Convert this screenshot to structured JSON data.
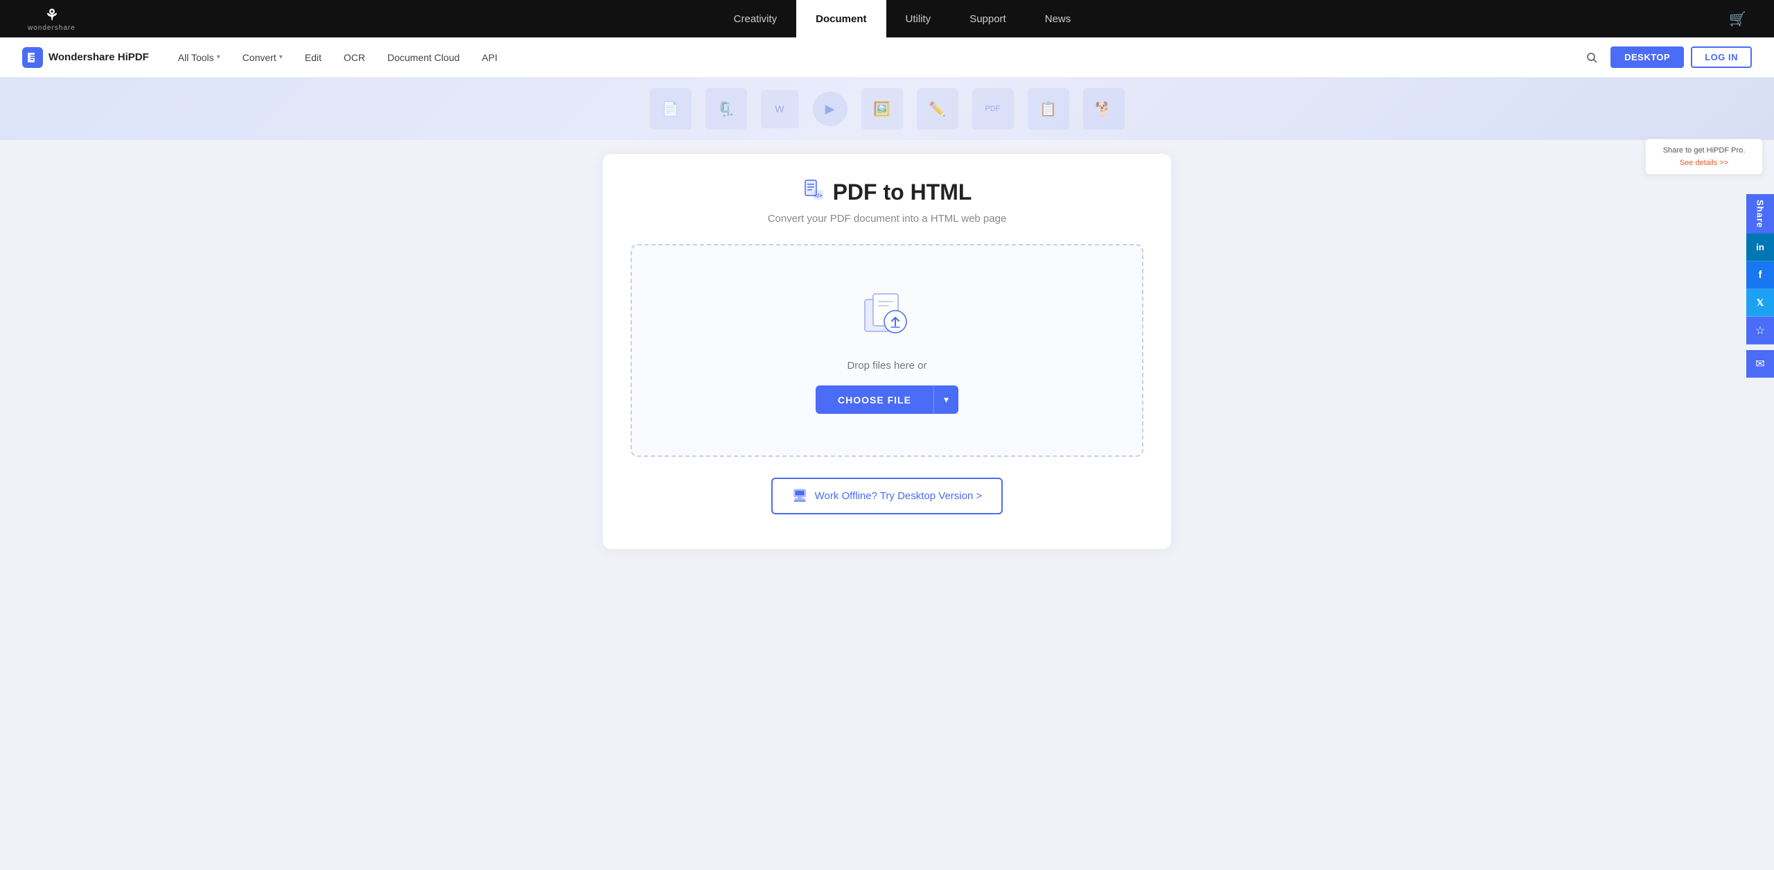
{
  "topNav": {
    "logo": {
      "icon": "⌘",
      "text": "wondershare"
    },
    "links": [
      {
        "id": "creativity",
        "label": "Creativity",
        "active": false
      },
      {
        "id": "document",
        "label": "Document",
        "active": true
      },
      {
        "id": "utility",
        "label": "Utility",
        "active": false
      },
      {
        "id": "support",
        "label": "Support",
        "active": false
      },
      {
        "id": "news",
        "label": "News",
        "active": false
      }
    ],
    "cartIcon": "🛒"
  },
  "secondaryNav": {
    "brand": {
      "name": "Wondershare HiPDF"
    },
    "links": [
      {
        "id": "all-tools",
        "label": "All Tools",
        "hasDropdown": true
      },
      {
        "id": "convert",
        "label": "Convert",
        "hasDropdown": true
      },
      {
        "id": "edit",
        "label": "Edit",
        "hasDropdown": false
      },
      {
        "id": "ocr",
        "label": "OCR",
        "hasDropdown": false
      },
      {
        "id": "document-cloud",
        "label": "Document Cloud",
        "hasDropdown": false
      },
      {
        "id": "api",
        "label": "API",
        "hasDropdown": false
      }
    ],
    "desktopButton": "DESKTOP",
    "loginButton": "LOG IN"
  },
  "shareSidebar": {
    "promoText": "Share to get HiPDF Pro.",
    "promoLink": "See details >>",
    "shareLabel": "Share",
    "social": [
      {
        "id": "linkedin",
        "icon": "in",
        "label": "LinkedIn"
      },
      {
        "id": "facebook",
        "icon": "f",
        "label": "Facebook"
      },
      {
        "id": "twitter",
        "icon": "𝕏",
        "label": "Twitter"
      },
      {
        "id": "star",
        "icon": "☆",
        "label": "Bookmark"
      }
    ],
    "emailIcon": "✉"
  },
  "main": {
    "pageTitle": "PDF to HTML",
    "pageSubtitle": "Convert your PDF document into a HTML web page",
    "dropZone": {
      "dropText": "Drop files here or",
      "chooseFileLabel": "CHOOSE FILE"
    },
    "desktopCta": "Work Offline? Try Desktop Version >"
  }
}
